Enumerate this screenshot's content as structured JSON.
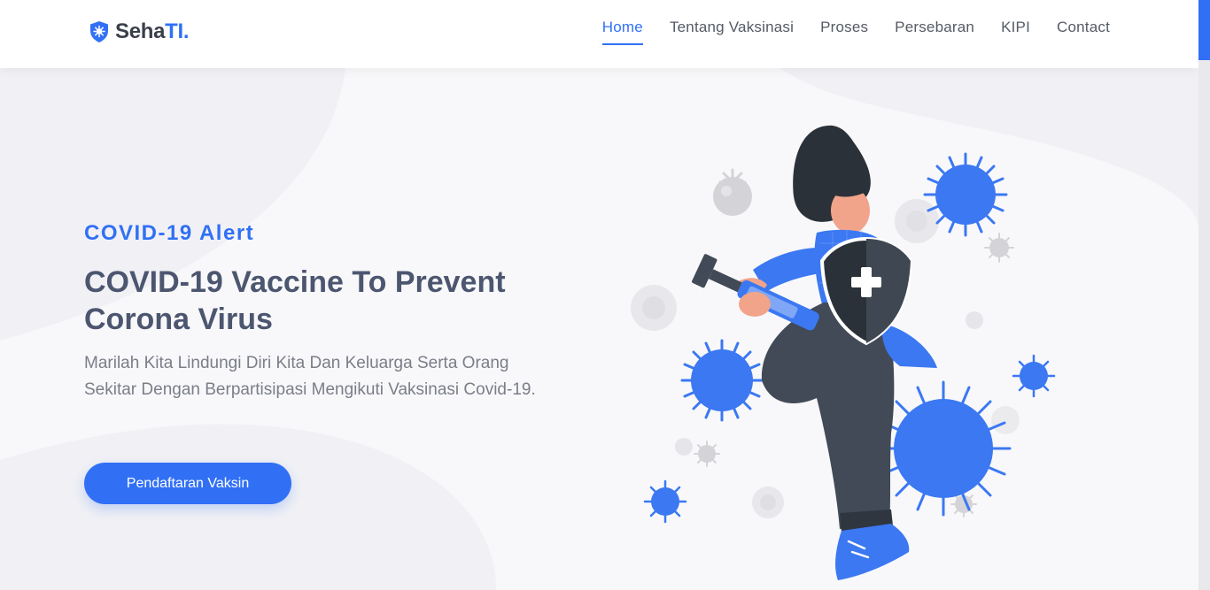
{
  "brand": {
    "name": "Seha",
    "accent": "TI."
  },
  "nav": {
    "items": [
      {
        "label": "Home",
        "active": true
      },
      {
        "label": "Tentang Vaksinasi",
        "active": false
      },
      {
        "label": "Proses",
        "active": false
      },
      {
        "label": "Persebaran",
        "active": false
      },
      {
        "label": "KIPI",
        "active": false
      },
      {
        "label": "Contact",
        "active": false
      }
    ]
  },
  "hero": {
    "eyebrow": "COVID-19 Alert",
    "headline": "COVID-19 Vaccine To Prevent Corona Virus",
    "lead": "Marilah Kita Lindungi Diri Kita Dan Keluarga Serta Orang Sekitar Dengan Berpartisipasi Mengikuti Vaksinasi Covid-19.",
    "cta_label": "Pendaftaran Vaksin"
  },
  "colors": {
    "accent": "#3170f5",
    "heading": "#4c5670",
    "body_text": "#7a7e88",
    "background": "#f4f4f8"
  },
  "icons": {
    "brand_logo": "shield-virus-icon",
    "shield": "shield-plus-icon",
    "virus": "virus-icon"
  }
}
